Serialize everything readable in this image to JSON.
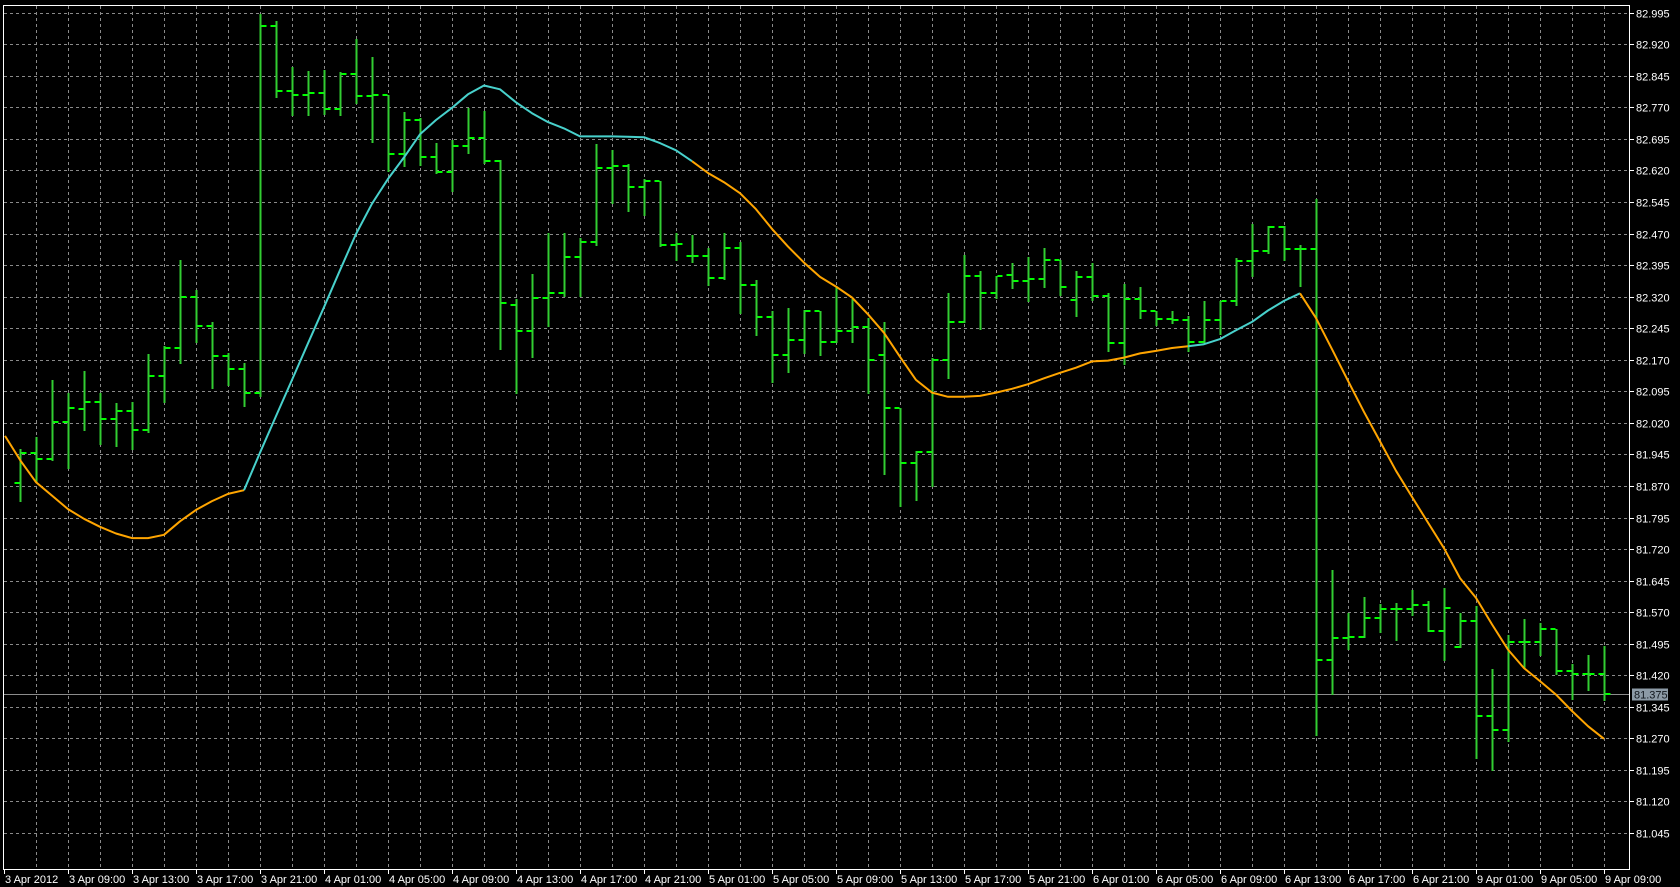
{
  "chart_data": {
    "type": "ohlc",
    "title": "",
    "xlabel": "",
    "ylabel": "",
    "ylim": [
      81.045,
      82.995
    ],
    "grid": true,
    "legend": "none",
    "colors": {
      "background": "#000000",
      "bar": "#32CD32",
      "bar_tick": "#00FF00",
      "grid": "#8A8A8A",
      "frame": "#FFFFFF",
      "ma_orange": "#FFA500",
      "ma_cyan": "#48D1CC",
      "current_price_line": "#8C8C8C",
      "current_price_label_bg": "#8C9AA6"
    },
    "y_ticks": [
      "82.995",
      "82.920",
      "82.845",
      "82.770",
      "82.695",
      "82.620",
      "82.545",
      "82.470",
      "82.395",
      "82.320",
      "82.245",
      "82.170",
      "82.095",
      "82.020",
      "81.945",
      "81.870",
      "81.795",
      "81.720",
      "81.645",
      "81.570",
      "81.495",
      "81.420",
      "81.345",
      "81.270",
      "81.195",
      "81.120",
      "81.045"
    ],
    "current_price": "81.375",
    "x_labels": [
      {
        "bar": -1,
        "text": "3 Apr 2012"
      },
      {
        "bar": 3,
        "text": "3 Apr 09:00"
      },
      {
        "bar": 7,
        "text": "3 Apr 13:00"
      },
      {
        "bar": 11,
        "text": "3 Apr 17:00"
      },
      {
        "bar": 15,
        "text": "3 Apr 21:00"
      },
      {
        "bar": 19,
        "text": "4 Apr 01:00"
      },
      {
        "bar": 23,
        "text": "4 Apr 05:00"
      },
      {
        "bar": 27,
        "text": "4 Apr 09:00"
      },
      {
        "bar": 31,
        "text": "4 Apr 13:00"
      },
      {
        "bar": 35,
        "text": "4 Apr 17:00"
      },
      {
        "bar": 39,
        "text": "4 Apr 21:00"
      },
      {
        "bar": 43,
        "text": "5 Apr 01:00"
      },
      {
        "bar": 47,
        "text": "5 Apr 05:00"
      },
      {
        "bar": 51,
        "text": "5 Apr 09:00"
      },
      {
        "bar": 55,
        "text": "5 Apr 13:00"
      },
      {
        "bar": 59,
        "text": "5 Apr 17:00"
      },
      {
        "bar": 63,
        "text": "5 Apr 21:00"
      },
      {
        "bar": 67,
        "text": "6 Apr 01:00"
      },
      {
        "bar": 71,
        "text": "6 Apr 05:00"
      },
      {
        "bar": 75,
        "text": "6 Apr 09:00"
      },
      {
        "bar": 79,
        "text": "6 Apr 13:00"
      },
      {
        "bar": 83,
        "text": "6 Apr 17:00"
      },
      {
        "bar": 87,
        "text": "6 Apr 21:00"
      },
      {
        "bar": 91,
        "text": "9 Apr 01:00"
      },
      {
        "bar": 95,
        "text": "9 Apr 05:00"
      },
      {
        "bar": 99,
        "text": "9 Apr 09:00"
      }
    ],
    "ohlc_fields": [
      "open",
      "high",
      "low",
      "close"
    ],
    "bars": [
      [
        81.877,
        81.957,
        81.834,
        81.949
      ],
      [
        81.949,
        81.987,
        81.881,
        81.933
      ],
      [
        81.933,
        82.122,
        81.932,
        82.022
      ],
      [
        82.022,
        82.09,
        81.913,
        82.056
      ],
      [
        82.052,
        82.143,
        82.004,
        82.069
      ],
      [
        82.069,
        82.09,
        81.97,
        82.029
      ],
      [
        82.029,
        82.067,
        81.965,
        82.048
      ],
      [
        82.048,
        82.07,
        81.959,
        82.004
      ],
      [
        82.004,
        82.183,
        81.999,
        82.132
      ],
      [
        82.132,
        82.202,
        82.07,
        82.198
      ],
      [
        82.198,
        82.408,
        82.162,
        82.318
      ],
      [
        82.318,
        82.335,
        82.212,
        82.251
      ],
      [
        82.251,
        82.259,
        82.103,
        82.179
      ],
      [
        82.179,
        82.187,
        82.109,
        82.147
      ],
      [
        82.147,
        82.162,
        82.059,
        82.09
      ],
      [
        82.09,
        82.991,
        82.084,
        82.964
      ],
      [
        82.964,
        82.976,
        82.795,
        82.81
      ],
      [
        82.81,
        82.866,
        82.752,
        82.799
      ],
      [
        82.799,
        82.856,
        82.752,
        82.805
      ],
      [
        82.805,
        82.858,
        82.754,
        82.767
      ],
      [
        82.767,
        82.854,
        82.752,
        82.85
      ],
      [
        82.85,
        82.932,
        82.78,
        82.796
      ],
      [
        82.796,
        82.889,
        82.687,
        82.799
      ],
      [
        82.799,
        82.799,
        82.619,
        82.659
      ],
      [
        82.659,
        82.758,
        82.631,
        82.741
      ],
      [
        82.741,
        82.744,
        82.634,
        82.652
      ],
      [
        82.652,
        82.685,
        82.613,
        82.617
      ],
      [
        82.617,
        82.693,
        82.57,
        82.678
      ],
      [
        82.678,
        82.769,
        82.661,
        82.697
      ],
      [
        82.697,
        82.762,
        82.638,
        82.642
      ],
      [
        82.642,
        82.644,
        82.196,
        82.306
      ],
      [
        82.301,
        82.314,
        82.09,
        82.238
      ],
      [
        82.238,
        82.373,
        82.177,
        82.317
      ],
      [
        82.317,
        82.471,
        82.251,
        82.329
      ],
      [
        82.329,
        82.471,
        82.321,
        82.414
      ],
      [
        82.414,
        82.46,
        82.321,
        82.449
      ],
      [
        82.449,
        82.682,
        82.443,
        82.625
      ],
      [
        82.625,
        82.668,
        82.542,
        82.631
      ],
      [
        82.631,
        82.635,
        82.524,
        82.58
      ],
      [
        82.58,
        82.6,
        82.515,
        82.596
      ],
      [
        82.596,
        82.596,
        82.441,
        82.443
      ],
      [
        82.443,
        82.471,
        82.408,
        82.445
      ],
      [
        82.416,
        82.466,
        82.403,
        82.417
      ],
      [
        82.417,
        82.435,
        82.348,
        82.365
      ],
      [
        82.365,
        82.471,
        82.363,
        82.435
      ],
      [
        82.435,
        82.45,
        82.28,
        82.348
      ],
      [
        82.348,
        82.359,
        82.228,
        82.272
      ],
      [
        82.272,
        82.287,
        82.118,
        82.181
      ],
      [
        82.181,
        82.294,
        82.141,
        82.218
      ],
      [
        82.218,
        82.289,
        82.187,
        82.287
      ],
      [
        82.287,
        82.287,
        82.181,
        82.212
      ],
      [
        82.212,
        82.346,
        82.212,
        82.238
      ],
      [
        82.238,
        82.314,
        82.212,
        82.249
      ],
      [
        82.249,
        82.27,
        82.09,
        82.17
      ],
      [
        82.181,
        82.259,
        81.899,
        82.056
      ],
      [
        82.056,
        82.056,
        81.823,
        81.925
      ],
      [
        81.925,
        81.953,
        81.836,
        81.95
      ],
      [
        81.95,
        82.174,
        81.87,
        82.169
      ],
      [
        82.169,
        82.329,
        82.126,
        82.259
      ],
      [
        82.259,
        82.42,
        82.259,
        82.369
      ],
      [
        82.369,
        82.38,
        82.242,
        82.329
      ],
      [
        82.329,
        82.37,
        82.317,
        82.369
      ],
      [
        82.372,
        82.399,
        82.341,
        82.357
      ],
      [
        82.357,
        82.414,
        82.31,
        82.363
      ],
      [
        82.363,
        82.435,
        82.342,
        82.408
      ],
      [
        82.408,
        82.408,
        82.324,
        82.344
      ],
      [
        82.312,
        82.382,
        82.274,
        82.367
      ],
      [
        82.367,
        82.401,
        82.311,
        82.322
      ],
      [
        82.322,
        82.328,
        82.19,
        82.211
      ],
      [
        82.211,
        82.349,
        82.16,
        82.314
      ],
      [
        82.314,
        82.342,
        82.27,
        82.287
      ],
      [
        82.287,
        82.287,
        82.253,
        82.268
      ],
      [
        82.268,
        82.287,
        82.257,
        82.264
      ],
      [
        82.264,
        82.274,
        82.19,
        82.212
      ],
      [
        82.212,
        82.31,
        82.211,
        82.264
      ],
      [
        82.264,
        82.31,
        82.232,
        82.31
      ],
      [
        82.31,
        82.411,
        82.3,
        82.405
      ],
      [
        82.405,
        82.492,
        82.368,
        82.429
      ],
      [
        82.429,
        82.488,
        82.424,
        82.485
      ],
      [
        82.485,
        82.488,
        82.407,
        82.433
      ],
      [
        82.433,
        82.442,
        82.345,
        82.433
      ],
      [
        82.433,
        82.552,
        81.279,
        81.456
      ],
      [
        81.456,
        81.671,
        81.376,
        81.509
      ],
      [
        81.509,
        81.568,
        81.483,
        81.512
      ],
      [
        81.512,
        81.605,
        81.512,
        81.555
      ],
      [
        81.555,
        81.59,
        81.522,
        81.577
      ],
      [
        81.577,
        81.592,
        81.504,
        81.577
      ],
      [
        81.577,
        81.623,
        81.564,
        81.586
      ],
      [
        81.586,
        81.596,
        81.526,
        81.526
      ],
      [
        81.526,
        81.628,
        81.457,
        81.579
      ],
      [
        81.487,
        81.568,
        81.487,
        81.548
      ],
      [
        81.548,
        81.584,
        81.224,
        81.324
      ],
      [
        81.324,
        81.435,
        81.195,
        81.291
      ],
      [
        81.291,
        81.515,
        81.263,
        81.498
      ],
      [
        81.498,
        81.554,
        81.437,
        81.498
      ],
      [
        81.498,
        81.544,
        81.469,
        81.531
      ],
      [
        81.531,
        81.531,
        81.423,
        81.431
      ],
      [
        81.431,
        81.447,
        81.364,
        81.423
      ],
      [
        81.423,
        81.468,
        81.386,
        81.423
      ],
      [
        81.423,
        81.489,
        81.362,
        81.376
      ]
    ],
    "moving_average": {
      "first_bar": -1,
      "values": [
        81.989,
        81.932,
        81.879,
        81.847,
        81.815,
        81.792,
        81.773,
        81.757,
        81.746,
        81.746,
        81.754,
        81.786,
        81.813,
        81.834,
        81.851,
        81.86,
        81.949,
        82.036,
        82.122,
        82.209,
        82.295,
        82.383,
        82.469,
        82.541,
        82.6,
        82.651,
        82.706,
        82.74,
        82.769,
        82.801,
        82.822,
        82.813,
        82.782,
        82.756,
        82.735,
        82.72,
        82.701,
        82.701,
        82.701,
        82.7,
        82.699,
        82.685,
        82.668,
        82.642,
        82.614,
        82.592,
        82.566,
        82.528,
        82.481,
        82.439,
        82.401,
        82.367,
        82.344,
        82.318,
        82.278,
        82.234,
        82.177,
        82.122,
        82.092,
        82.082,
        82.082,
        82.084,
        82.092,
        82.101,
        82.112,
        82.126,
        82.139,
        82.151,
        82.166,
        82.168,
        82.175,
        82.185,
        82.191,
        82.198,
        82.202,
        82.207,
        82.219,
        82.24,
        82.26,
        82.287,
        82.31,
        82.328,
        82.269,
        82.195,
        82.12,
        82.046,
        81.976,
        81.906,
        81.844,
        81.783,
        81.722,
        81.651,
        81.604,
        81.541,
        81.481,
        81.437,
        81.406,
        81.374,
        81.335,
        81.299,
        81.269
      ],
      "segments": [
        {
          "from_bar": -1,
          "to_bar": 14,
          "color": "#FFA500"
        },
        {
          "from_bar": 14,
          "to_bar": 42,
          "color": "#48D1CC"
        },
        {
          "from_bar": 42,
          "to_bar": 73,
          "color": "#FFA500"
        },
        {
          "from_bar": 73,
          "to_bar": 80,
          "color": "#48D1CC"
        },
        {
          "from_bar": 80,
          "to_bar": 99,
          "color": "#FFA500"
        }
      ]
    }
  }
}
